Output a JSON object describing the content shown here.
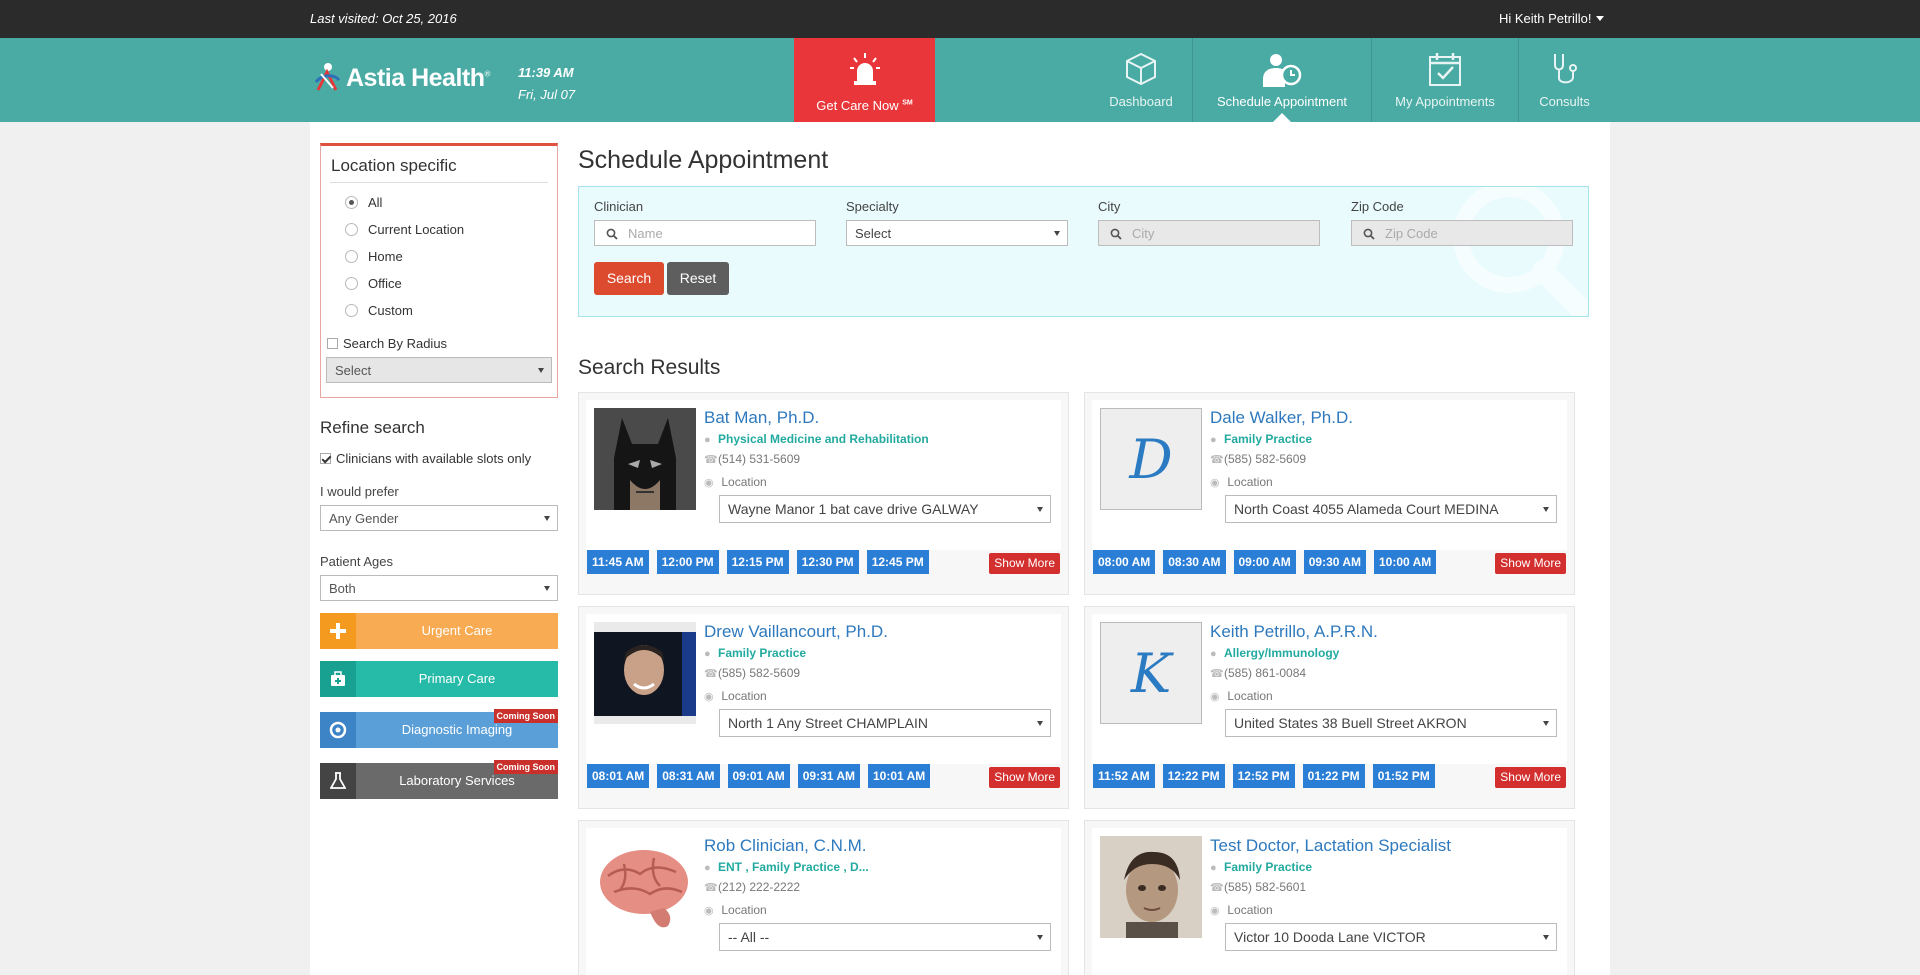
{
  "topbar": {
    "last_visited": "Last visited: Oct 25, 2016",
    "greeting": "Hi Keith Petrillo!"
  },
  "header": {
    "logo_text": "Astia Health",
    "time": "11:39 AM",
    "date": "Fri, Jul 07",
    "care_now": "Get Care Now",
    "care_now_mark": "SM",
    "nav": [
      {
        "label": "Dashboard",
        "icon": "cube-icon"
      },
      {
        "label": "Schedule Appointment",
        "icon": "doctor-clock-icon",
        "active": true
      },
      {
        "label": "My Appointments",
        "icon": "calendar-check-icon"
      },
      {
        "label": "Consults",
        "icon": "stethoscope-icon"
      }
    ]
  },
  "sidebar": {
    "location_title": "Location specific",
    "location_options": [
      "All",
      "Current Location",
      "Home",
      "Office",
      "Custom"
    ],
    "selected_location": "All",
    "search_by_radius": "Search By Radius",
    "radius_select": "Select",
    "refine_title": "Refine search",
    "available_only": "Clinicians with available slots only",
    "prefer_label": "I would prefer",
    "gender_select": "Any Gender",
    "ages_label": "Patient Ages",
    "ages_select": "Both",
    "services": [
      {
        "label": "Urgent Care",
        "color": "#f8ab52",
        "icon_bg": "#f39a1f",
        "icon": "plus-icon"
      },
      {
        "label": "Primary Care",
        "color": "#26bba8",
        "icon_bg": "#18a090",
        "icon": "medkit-icon"
      },
      {
        "label": "Diagnostic Imaging",
        "color": "#5a9fd8",
        "icon_bg": "#3c84c6",
        "icon": "target-icon",
        "badge": "Coming Soon"
      },
      {
        "label": "Laboratory Services",
        "color": "#6a6a6a",
        "icon_bg": "#444444",
        "icon": "flask-icon",
        "badge": "Coming Soon"
      }
    ]
  },
  "main": {
    "title": "Schedule Appointment",
    "filters": {
      "clinician_label": "Clinician",
      "clinician_placeholder": "Name",
      "specialty_label": "Specialty",
      "specialty_value": "Select",
      "city_label": "City",
      "city_placeholder": "City",
      "zip_label": "Zip Code",
      "zip_placeholder": "Zip Code"
    },
    "search_btn": "Search",
    "reset_btn": "Reset",
    "results_title": "Search Results",
    "show_more": "Show More",
    "phone_icon": "phone-icon",
    "location_label": "Location",
    "results": [
      {
        "name": "Bat Man, Ph.D.",
        "specialty": "Physical Medicine and Rehabilitation",
        "phone": "(514) 531-5609",
        "location": "Wayne Manor 1 bat cave drive GALWAY",
        "photo": "batman-photo",
        "slots": [
          "11:45 AM",
          "12:00 PM",
          "12:15 PM",
          "12:30 PM",
          "12:45 PM"
        ]
      },
      {
        "name": "Dale Walker, Ph.D.",
        "specialty": "Family Practice",
        "phone": "(585) 582-5609",
        "location": "North Coast 4055 Alameda Court MEDINA",
        "photo": "letter-avatar",
        "letter": "D",
        "slots": [
          "08:00 AM",
          "08:30 AM",
          "09:00 AM",
          "09:30 AM",
          "10:00 AM"
        ]
      },
      {
        "name": "Drew Vaillancourt, Ph.D.",
        "specialty": "Family Practice",
        "phone": "(585) 582-5609",
        "location": "North 1 Any Street CHAMPLAIN",
        "photo": "portrait-photo",
        "slots": [
          "08:01 AM",
          "08:31 AM",
          "09:01 AM",
          "09:31 AM",
          "10:01 AM"
        ]
      },
      {
        "name": "Keith Petrillo, A.P.R.N.",
        "specialty": "Allergy/Immunology",
        "phone": "(585) 861-0084",
        "location": "United States 38 Buell Street AKRON",
        "photo": "letter-avatar",
        "letter": "K",
        "slots": [
          "11:52 AM",
          "12:22 PM",
          "12:52 PM",
          "01:22 PM",
          "01:52 PM"
        ]
      },
      {
        "name": "Rob Clinician, C.N.M.",
        "specialty": "ENT , Family Practice , D...",
        "phone": "(212) 222-2222",
        "location": "-- All --",
        "photo": "brain-photo"
      },
      {
        "name": "Test Doctor, Lactation Specialist",
        "specialty": "Family Practice",
        "phone": "(585) 582-5601",
        "location": "Victor 10 Dooda Lane VICTOR",
        "photo": "child-photo"
      }
    ]
  }
}
